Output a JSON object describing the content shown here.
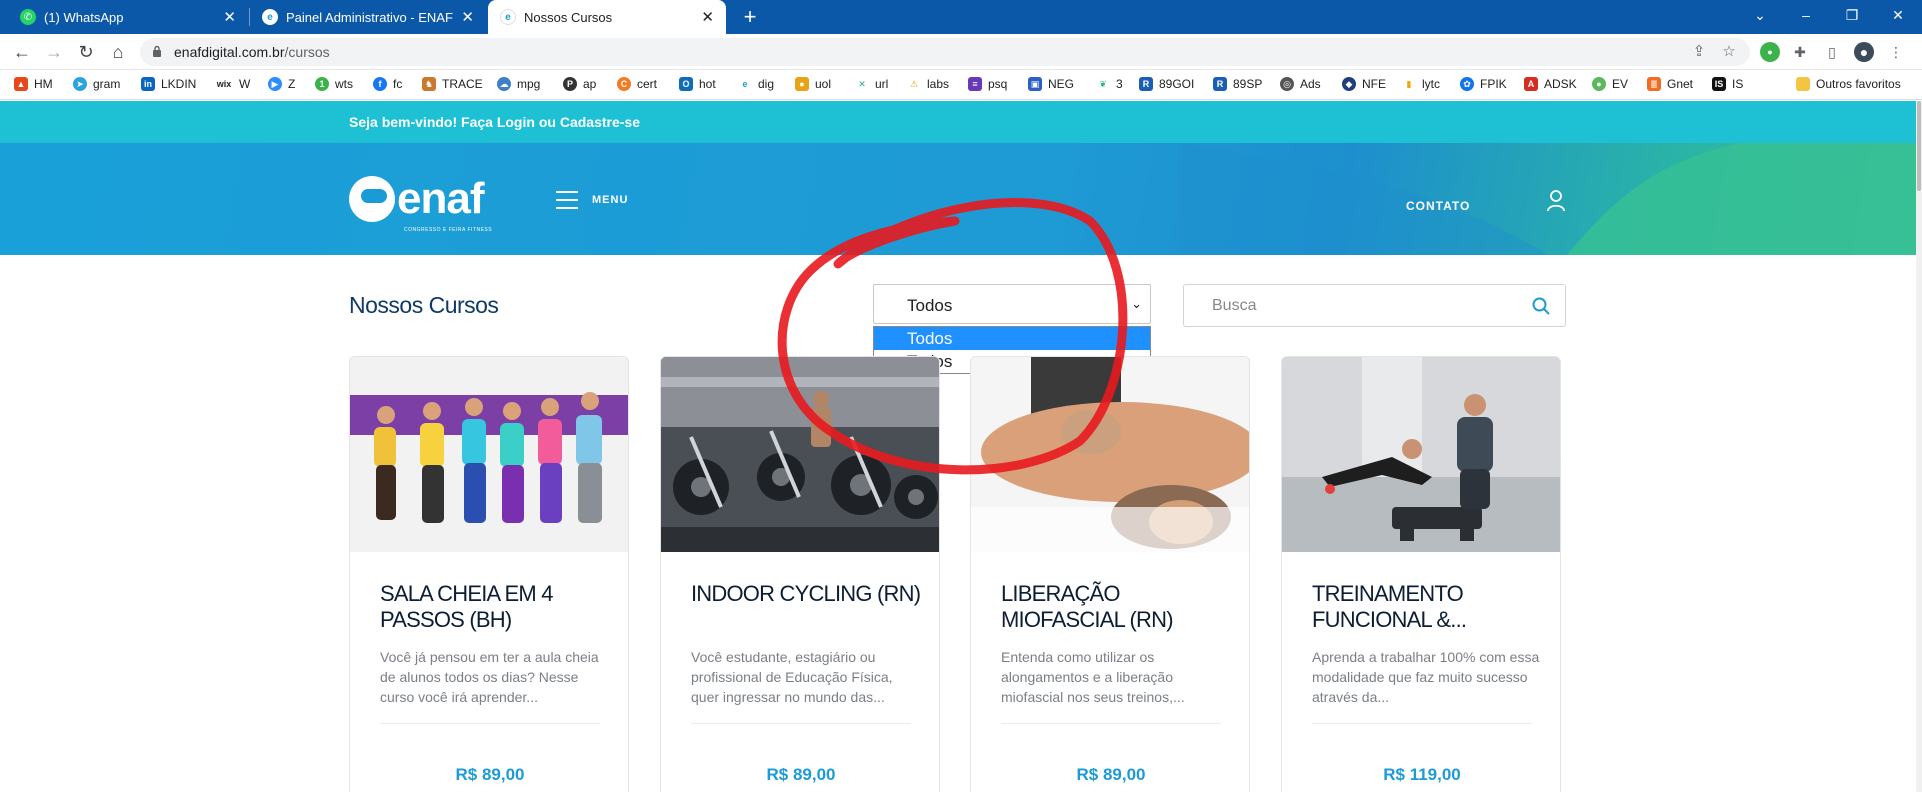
{
  "browser": {
    "tabs": [
      {
        "title": "(1) WhatsApp",
        "active": false
      },
      {
        "title": "Painel Administrativo - ENAF",
        "active": false
      },
      {
        "title": "Nossos Cursos",
        "active": true
      }
    ],
    "url_domain": "enafdigital.com.br",
    "url_path": "/cursos",
    "window_controls": {
      "minimize": "–",
      "restore": "❐",
      "close": "✕"
    },
    "bookmarks": [
      "HM",
      "gram",
      "LKDIN",
      "W",
      "Z",
      "wts",
      "fc",
      "TRACE",
      "mpg",
      "ap",
      "cert",
      "hot",
      "dig",
      "uol",
      "url",
      "labs",
      "psq",
      "NEG",
      "3",
      "89GOI",
      "89SP",
      "Ads",
      "NFE",
      "lytc",
      "FPIK",
      "ADSK",
      "EV",
      "Gnet",
      "IS"
    ],
    "bookmarks_other": "Outros favoritos"
  },
  "site": {
    "welcome_prefix": "Seja bem-vindo! Faça",
    "login": "Login",
    "or": "ou",
    "register": "Cadastre-se",
    "logo_text": "enaf",
    "logo_tagline": "CONGRESSO E FEIRA FITNESS",
    "menu_label": "MENU",
    "contact_label": "CONTATO",
    "section_title": "Nossos Cursos",
    "filter": {
      "selected": "Todos",
      "options": [
        "Todos",
        "Todos"
      ]
    },
    "search_placeholder": "Busca"
  },
  "courses": [
    {
      "title": "SALA CHEIA EM 4 PASSOS (BH)",
      "description": "Você já pensou em ter a aula cheia de alunos todos os dias? Nesse curso você irá aprender...",
      "price": "R$ 89,00"
    },
    {
      "title": "INDOOR CYCLING (RN)",
      "description": "Você estudante, estagiário ou profissional de Educação Física, quer ingressar no mundo das...",
      "price": "R$ 89,00"
    },
    {
      "title": "LIBERAÇÃO MIOFASCIAL (RN)",
      "description": "Entenda como utilizar os alongamentos e a liberação miofascial nos seus treinos,...",
      "price": "R$ 89,00"
    },
    {
      "title": "TREINAMENTO FUNCIONAL &...",
      "description": "Aprenda a trabalhar 100% com essa modalidade que faz muito sucesso através da...",
      "price": "R$ 119,00"
    }
  ],
  "colors": {
    "browser_blue": "#0b58a8",
    "welcome_bar": "#1ec0d4",
    "hero_blue": "#1aa0d8",
    "title_navy": "#0e3a66",
    "price_blue": "#1d9bd6",
    "annotation_red": "#e8191f",
    "option_highlight": "#1e90ff"
  }
}
